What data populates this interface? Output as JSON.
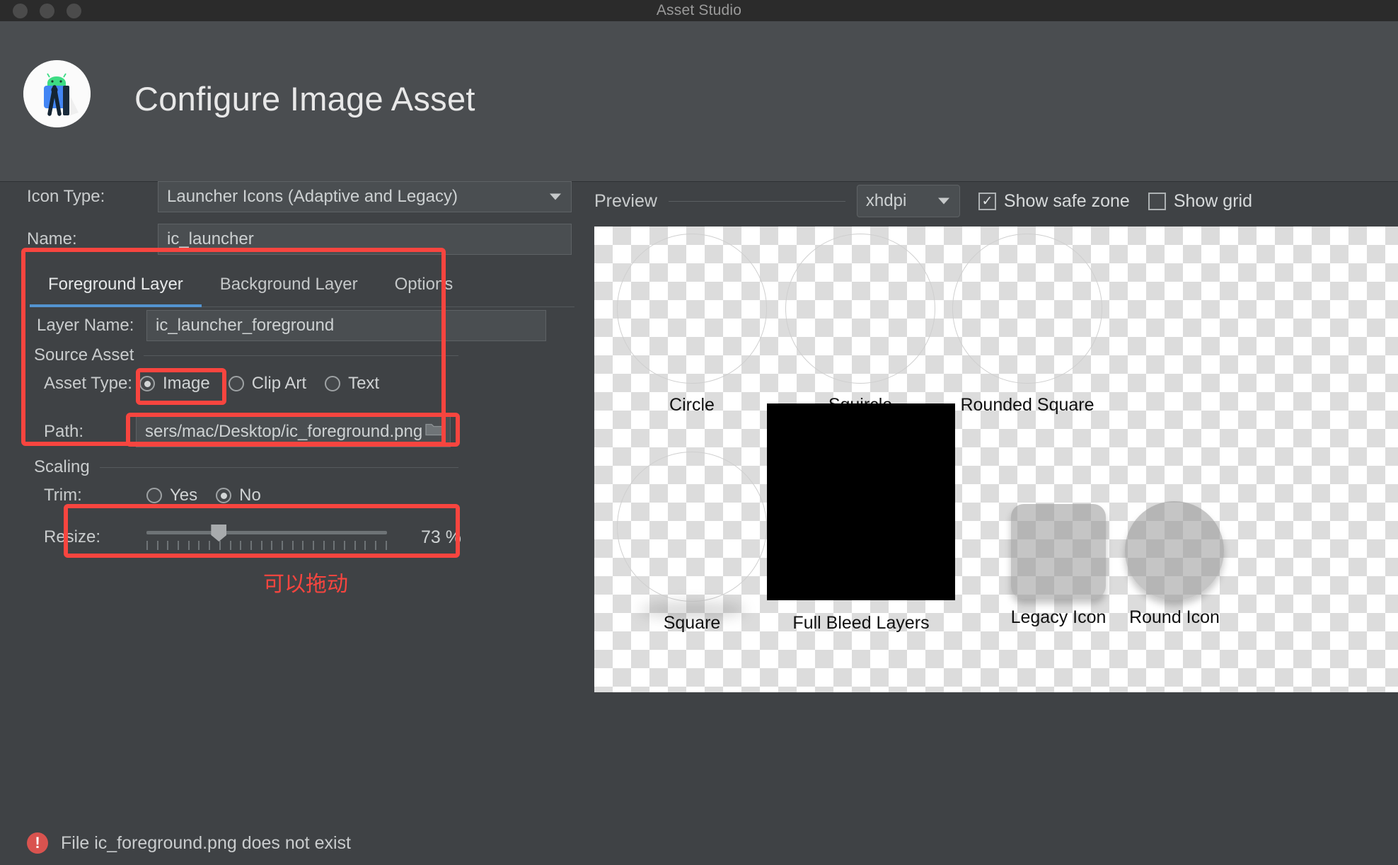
{
  "window": {
    "title": "Asset Studio",
    "traffic_lights": [
      "close",
      "minimize",
      "zoom"
    ]
  },
  "header": {
    "title": "Configure Image Asset",
    "logo": "android-studio-icon"
  },
  "form": {
    "icon_type": {
      "label": "Icon Type:",
      "value": "Launcher Icons (Adaptive and Legacy)"
    },
    "name": {
      "label": "Name:",
      "value": "ic_launcher"
    },
    "tabs": [
      {
        "label": "Foreground Layer",
        "active": true
      },
      {
        "label": "Background Layer",
        "active": false
      },
      {
        "label": "Options",
        "active": false
      }
    ],
    "layer_name": {
      "label": "Layer Name:",
      "value": "ic_launcher_foreground"
    },
    "source_asset": {
      "group_title": "Source Asset",
      "asset_type": {
        "label": "Asset Type:",
        "options": [
          "Image",
          "Clip Art",
          "Text"
        ],
        "selected": "Image"
      },
      "path": {
        "label": "Path:",
        "value": "sers/mac/Desktop/ic_foreground.png",
        "browse_icon": "folder-icon"
      }
    },
    "scaling": {
      "group_title": "Scaling",
      "trim": {
        "label": "Trim:",
        "options": [
          "Yes",
          "No"
        ],
        "selected": "No"
      },
      "resize": {
        "label": "Resize:",
        "value": "73 %",
        "percent": 73
      }
    }
  },
  "annotations": {
    "note_text": "可以拖动",
    "highlight_color": "#f8453f",
    "boxes": [
      "foreground-layer-section",
      "asset-type-image-radio",
      "path-field",
      "resize-slider"
    ]
  },
  "status": {
    "error_icon": "error-icon",
    "error_text": "File ic_foreground.png does not exist"
  },
  "preview": {
    "label": "Preview",
    "density": {
      "value": "xhdpi"
    },
    "show_safe_zone": {
      "label": "Show safe zone",
      "checked": true,
      "mark": "✓"
    },
    "show_grid": {
      "label": "Show grid",
      "checked": false,
      "mark": ""
    },
    "tiles": [
      {
        "label": "Circle",
        "shape": "outline-circle"
      },
      {
        "label": "Squircle",
        "shape": "outline-circle"
      },
      {
        "label": "Rounded Square",
        "shape": "outline-circle"
      },
      {
        "label": "Square",
        "shape": "outline-circle"
      },
      {
        "label": "Full Bleed Layers",
        "shape": "black-square"
      },
      {
        "label": "Legacy Icon",
        "shape": "rounded-square-translucent"
      },
      {
        "label": "Round Icon",
        "shape": "circle-translucent"
      }
    ]
  }
}
